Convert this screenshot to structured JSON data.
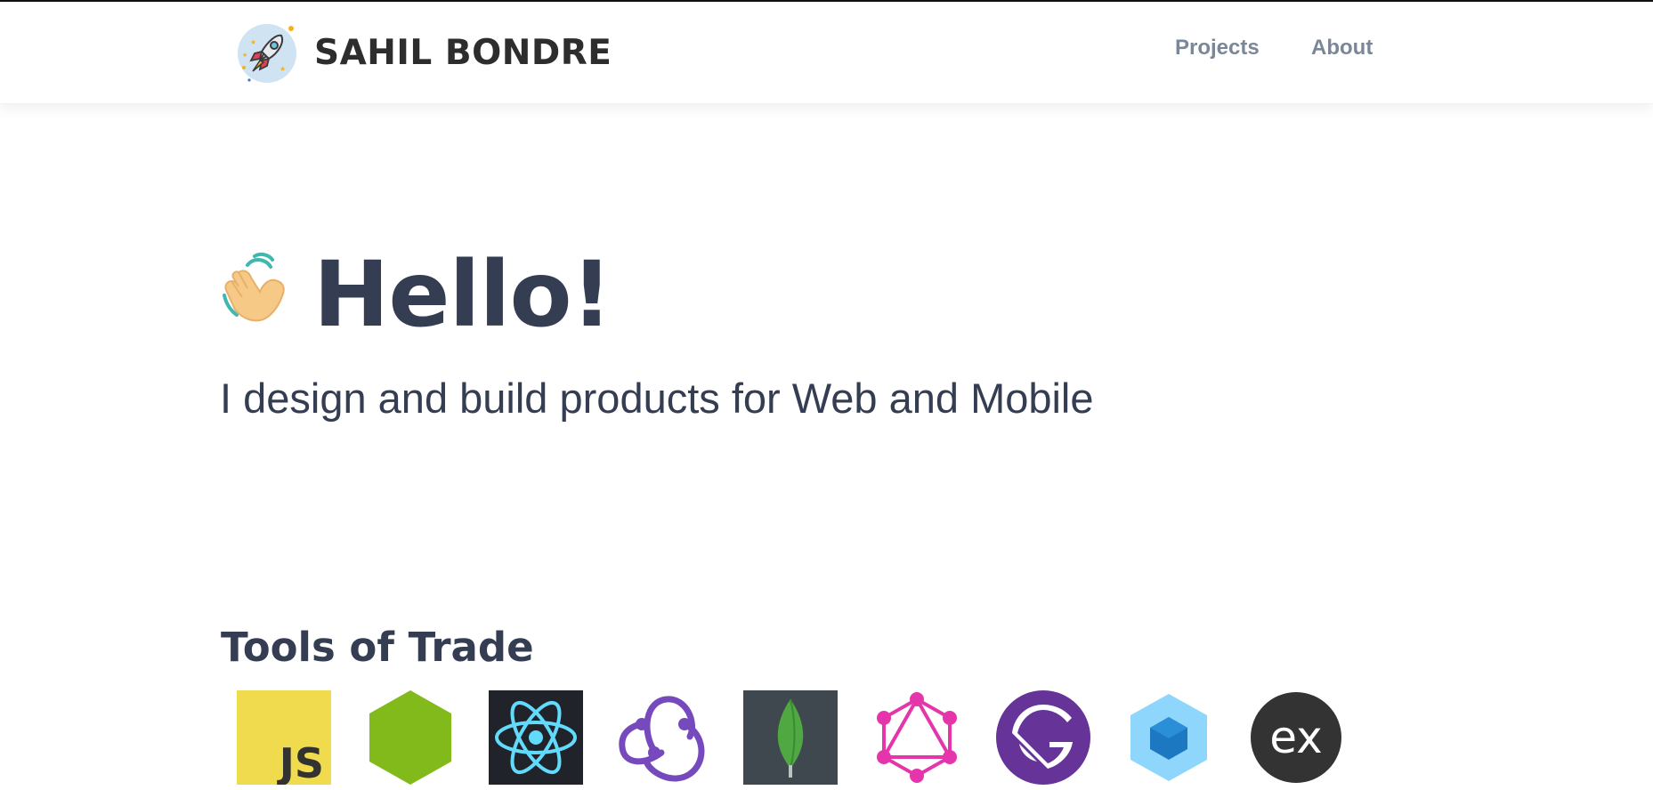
{
  "header": {
    "logo_icon": "rocket-icon",
    "brand": "SAHIL BONDRE",
    "nav": [
      {
        "label": "Projects"
      },
      {
        "label": "About"
      }
    ]
  },
  "hero": {
    "wave_icon": "waving-hand-icon",
    "title": "Hello!",
    "subtitle": "I design and build products for Web and Mobile"
  },
  "tools": {
    "heading": "Tools of Trade",
    "items": [
      {
        "icon": "javascript-icon",
        "glyph": "JS",
        "color": "#f0db4f"
      },
      {
        "icon": "nodejs-icon",
        "color": "#83ba1b"
      },
      {
        "icon": "react-icon",
        "color": "#61dafb"
      },
      {
        "icon": "redux-icon",
        "color": "#764abc"
      },
      {
        "icon": "mongodb-icon",
        "color": "#4fa841"
      },
      {
        "icon": "graphql-icon",
        "color": "#e535ab"
      },
      {
        "icon": "gatsby-icon",
        "color": "#663399"
      },
      {
        "icon": "webpack-icon",
        "color": "#8ed6fb"
      },
      {
        "icon": "express-icon",
        "glyph": "ex",
        "color": "#333333"
      }
    ]
  }
}
